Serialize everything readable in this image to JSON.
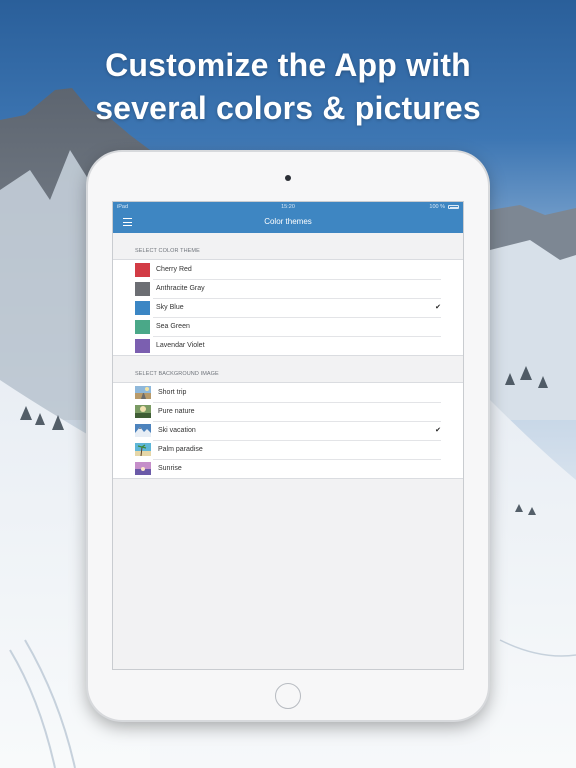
{
  "promo": {
    "headline_line1": "Customize the App with",
    "headline_line2": "several colors & pictures"
  },
  "device": {
    "status": {
      "carrier": "iPad",
      "time": "15:20",
      "battery": "100 %"
    },
    "navbar": {
      "title": "Color themes",
      "menu_icon": "hamburger-menu-icon"
    }
  },
  "color_section": {
    "header": "SELECT COLOR THEME",
    "items": [
      {
        "label": "Cherry Red",
        "color": "#d23b45",
        "selected": ""
      },
      {
        "label": "Anthracite Gray",
        "color": "#6c6e73",
        "selected": ""
      },
      {
        "label": "Sky Blue",
        "color": "#3b86c4",
        "selected": "✔"
      },
      {
        "label": "Sea Green",
        "color": "#4aa888",
        "selected": ""
      },
      {
        "label": "Lavendar Violet",
        "color": "#7b5fb0",
        "selected": ""
      }
    ]
  },
  "background_section": {
    "header": "SELECT BACKGROUND IMAGE",
    "items": [
      {
        "label": "Short trip",
        "thumb": "road-thumbnail",
        "selected": ""
      },
      {
        "label": "Pure nature",
        "thumb": "forest-thumbnail",
        "selected": ""
      },
      {
        "label": "Ski vacation",
        "thumb": "mountain-thumbnail",
        "selected": "✔"
      },
      {
        "label": "Palm paradise",
        "thumb": "palm-thumbnail",
        "selected": ""
      },
      {
        "label": "Sunrise",
        "thumb": "sunrise-thumbnail",
        "selected": ""
      }
    ]
  }
}
